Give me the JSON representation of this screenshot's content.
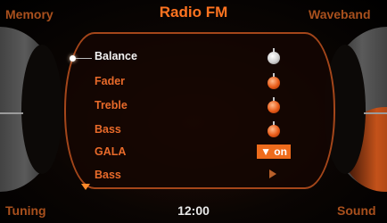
{
  "header": {
    "left_tab": "Memory",
    "title": "Radio FM",
    "right_tab": "Waveband"
  },
  "menu": {
    "items": [
      {
        "label": "Balance",
        "selected": true
      },
      {
        "label": "Fader"
      },
      {
        "label": "Treble"
      },
      {
        "label": "Bass"
      },
      {
        "label": "GALA"
      },
      {
        "label": "Bass"
      }
    ],
    "gala_value": "▼ on"
  },
  "footer": {
    "left": "Tuning",
    "time": "12:00",
    "right": "Sound"
  },
  "colors": {
    "accent": "#ff7320",
    "item_text": "#e86a2a",
    "selected_text": "#f2f2f2",
    "tab_text": "#a9501d"
  },
  "icons": {
    "slider_knob": "slider-knob-icon",
    "play": "play-icon",
    "scroll_down": "scroll-down-icon"
  }
}
